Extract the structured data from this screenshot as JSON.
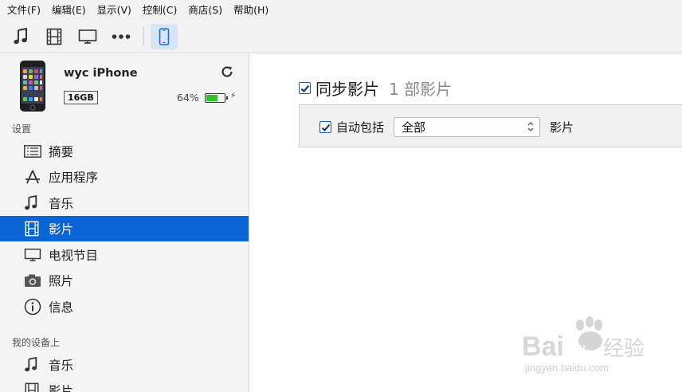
{
  "menu": [
    "文件(F)",
    "编辑(E)",
    "显示(V)",
    "控制(C)",
    "商店(S)",
    "帮助(H)"
  ],
  "toolbar": {
    "buttons": [
      "music-note-icon",
      "film-icon",
      "tv-icon",
      "more-icon",
      "iphone-icon"
    ],
    "active": "iphone-icon"
  },
  "device": {
    "name": "wyc iPhone",
    "capacity": "16GB",
    "battery_percent_label": "64%",
    "battery_level": 0.64,
    "battery_color": "#2fc12f"
  },
  "sidebar": {
    "settings_label": "设置",
    "settings_items": [
      {
        "label": "摘要",
        "icon": "summary-list-icon"
      },
      {
        "label": "应用程序",
        "icon": "apps-icon"
      },
      {
        "label": "音乐",
        "icon": "music-note-icon"
      },
      {
        "label": "影片",
        "icon": "film-icon",
        "selected": true
      },
      {
        "label": "电视节目",
        "icon": "tv-icon"
      },
      {
        "label": "照片",
        "icon": "camera-icon"
      },
      {
        "label": "信息",
        "icon": "info-icon"
      }
    ],
    "ondevice_label": "我的设备上",
    "ondevice_items": [
      {
        "label": "音乐",
        "icon": "music-note-icon"
      },
      {
        "label": "影片",
        "icon": "film-icon"
      }
    ],
    "selected_color": "#0a64d4"
  },
  "main": {
    "sync_checked": true,
    "sync_title": "同步影片",
    "sync_count": "1 部影片",
    "auto_include_checked": true,
    "auto_include_label": "自动包括",
    "auto_include_value": "全部",
    "auto_include_suffix": "影片"
  },
  "watermark": {
    "brand": "Bai",
    "brand_suffix": "经验",
    "url": "jingyan.baidu.com"
  }
}
